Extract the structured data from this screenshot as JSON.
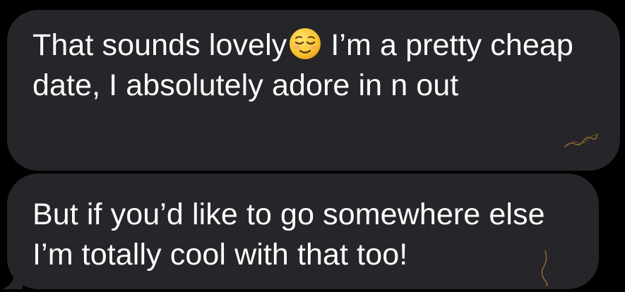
{
  "thread": {
    "messages": [
      {
        "text_before_emoji": "That sounds lovely",
        "emoji": "relieved-face-icon",
        "text_after_emoji": "I’m a pretty cheap date, I absolutely adore in n out"
      },
      {
        "text": "But if you’d like to go somewhere else I’m totally cool with that too!"
      }
    ]
  },
  "colors": {
    "background": "#000000",
    "bubble": "#262529",
    "text": "#ffffff",
    "scribble": "#8a6a2e"
  }
}
